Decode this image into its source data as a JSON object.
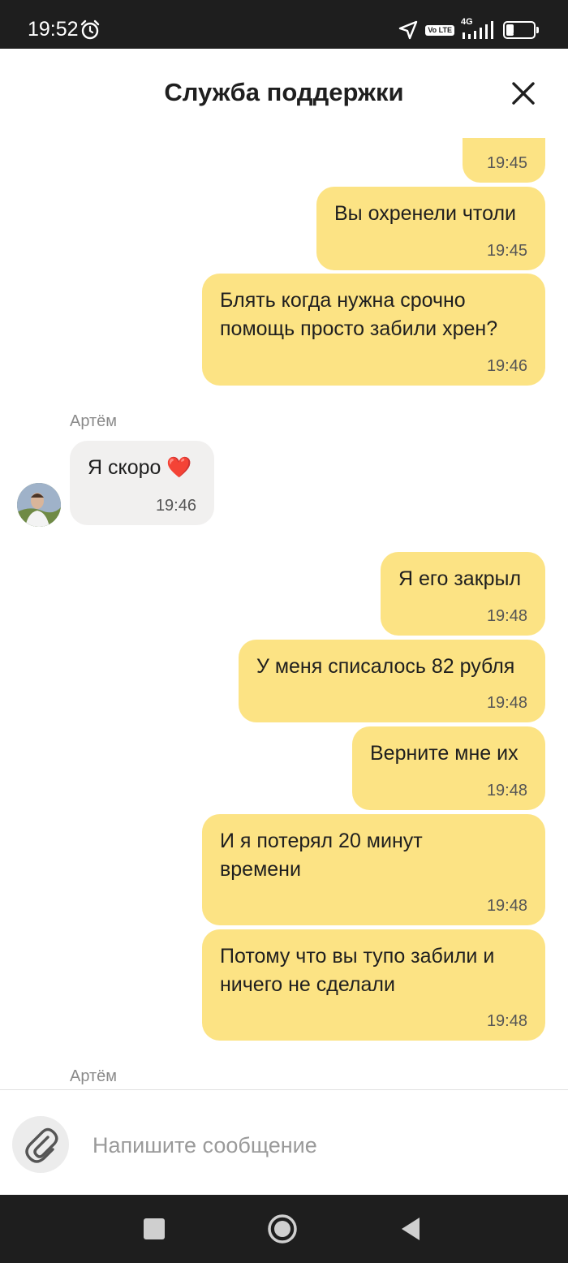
{
  "status_bar": {
    "time": "19:52",
    "network": "4G",
    "volte": "Vo LTE",
    "battery": "29",
    "battery_level": 0.29
  },
  "header": {
    "title": "Служба поддержки"
  },
  "messages": [
    {
      "text": "",
      "time": "19:45"
    },
    {
      "text": "Вы охренели чтоли",
      "time": "19:45"
    },
    {
      "text": "Блять когда нужна срочно\nпомощь просто забили хрен?",
      "time": "19:46"
    },
    {
      "sender": "Артём",
      "text": "Я скоро ❤️",
      "time": "19:46"
    },
    {
      "text": "Я его закрыл",
      "time": "19:48"
    },
    {
      "text": "У меня списалось 82 рубля",
      "time": "19:48"
    },
    {
      "text": "Верните мне их",
      "time": "19:48"
    },
    {
      "text": "И я потерял 20 минут\nвремени",
      "time": "19:48"
    },
    {
      "text": "Потому что вы тупо забили и\nничего не сделали",
      "time": "19:48"
    },
    {
      "sender": "Артём"
    }
  ],
  "input": {
    "placeholder": "Напишите сообщение"
  }
}
